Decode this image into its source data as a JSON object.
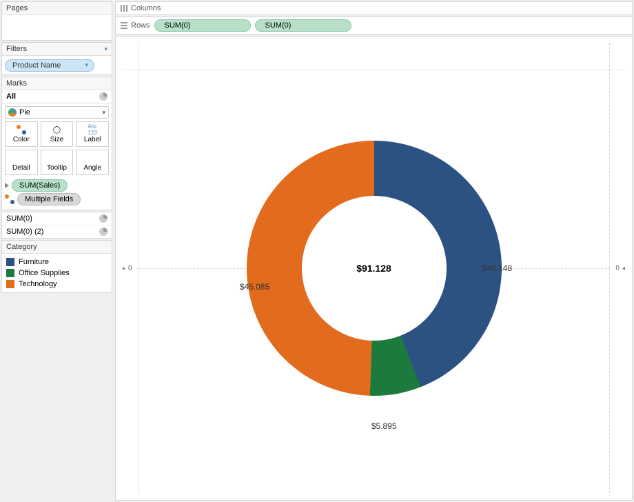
{
  "sidebar": {
    "pages_label": "Pages",
    "filters_label": "Filters",
    "filter_pill": "Product Name",
    "marks_label": "Marks",
    "marks_all": "All",
    "mark_type": "Pie",
    "mark_buttons": [
      "Color",
      "Size",
      "Label",
      "Detail",
      "Tooltip",
      "Angle"
    ],
    "mark_pills": [
      {
        "label": "SUM(Sales)",
        "variant": "green"
      },
      {
        "label": "Multiple Fields",
        "variant": "grey"
      }
    ],
    "sum_rows": [
      "SUM(0)",
      "SUM(0) (2)"
    ],
    "category_label": "Category",
    "legend": [
      {
        "label": "Furniture",
        "color": "#2c5282"
      },
      {
        "label": "Office Supplies",
        "color": "#1b7a3c"
      },
      {
        "label": "Technology",
        "color": "#e36b1e"
      }
    ]
  },
  "shelves": {
    "columns_label": "Columns",
    "rows_label": "Rows",
    "row_pills": [
      "SUM(0)",
      "SUM(0)"
    ]
  },
  "axis": {
    "zero": "0"
  },
  "chart_data": {
    "type": "pie",
    "title": "",
    "center_label": "$91.128",
    "series": [
      {
        "name": "Furniture",
        "value": 40.148,
        "label": "$40.148",
        "color": "#2c5282"
      },
      {
        "name": "Office Supplies",
        "value": 5.895,
        "label": "$5.895",
        "color": "#1b7a3c"
      },
      {
        "name": "Technology",
        "value": 45.085,
        "label": "$45.085",
        "color": "#e36b1e"
      }
    ],
    "total": 91.128,
    "donut": true
  }
}
